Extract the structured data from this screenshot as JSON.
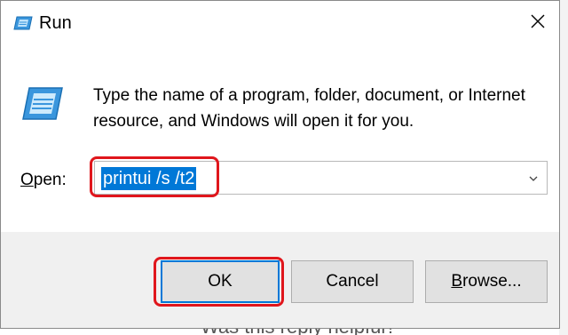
{
  "window": {
    "title": "Run",
    "close_glyph": "✕"
  },
  "dialog": {
    "description": "Type the name of a program, folder, document, or Internet resource, and Windows will open it for you.",
    "open_label_accel": "O",
    "open_label_rest": "pen:",
    "open_value": "printui /s /t2"
  },
  "buttons": {
    "ok": "OK",
    "cancel": "Cancel",
    "browse_accel": "B",
    "browse_rest": "rowse..."
  },
  "background": {
    "partial_caption": "Was this reply helpful?"
  },
  "icons": {
    "title": "run-icon",
    "body": "run-icon",
    "close": "close-icon",
    "dropdown": "chevron-down-icon"
  },
  "colors": {
    "selection": "#0078d7",
    "annotation": "#e0161c",
    "footer": "#f0f0f0"
  }
}
